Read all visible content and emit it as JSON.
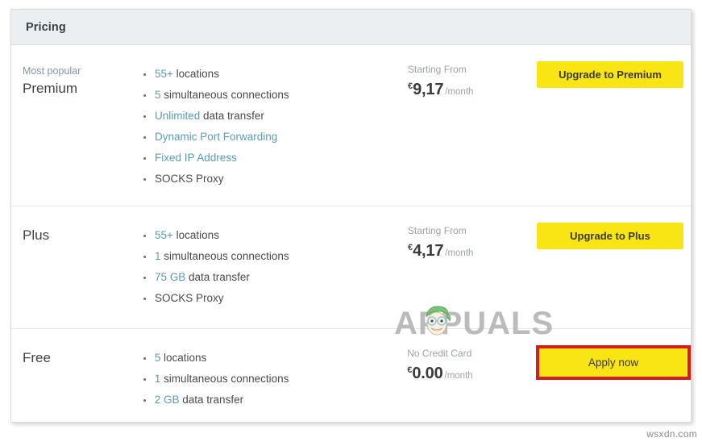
{
  "card": {
    "header_title": "Pricing"
  },
  "plans": [
    {
      "badge": "Most popular",
      "name": "Premium",
      "features": [
        {
          "highlight": "55+",
          "rest": " locations"
        },
        {
          "highlight": "5",
          "rest": " simultaneous connections"
        },
        {
          "highlight": "Unlimited",
          "rest": " data transfer"
        },
        {
          "highlight": "Dynamic Port Forwarding",
          "rest": ""
        },
        {
          "highlight": "Fixed IP Address",
          "rest": ""
        },
        {
          "highlight": "",
          "rest": "SOCKS Proxy"
        }
      ],
      "price_caption": "Starting From",
      "currency": "€",
      "amount": "9,17",
      "period": "/month",
      "button_label": "Upgrade to Premium",
      "highlighted": false
    },
    {
      "badge": "",
      "name": "Plus",
      "features": [
        {
          "highlight": "55+",
          "rest": " locations"
        },
        {
          "highlight": "1",
          "rest": " simultaneous connections"
        },
        {
          "highlight": "75 GB",
          "rest": " data transfer"
        },
        {
          "highlight": "",
          "rest": "SOCKS Proxy"
        }
      ],
      "price_caption": "Starting From",
      "currency": "€",
      "amount": "4,17",
      "period": "/month",
      "button_label": "Upgrade to Plus",
      "highlighted": false
    },
    {
      "badge": "",
      "name": "Free",
      "features": [
        {
          "highlight": "5",
          "rest": " locations"
        },
        {
          "highlight": "1",
          "rest": " simultaneous connections"
        },
        {
          "highlight": "2 GB",
          "rest": " data transfer"
        }
      ],
      "price_caption": "No Credit Card",
      "currency": "€",
      "amount": "0.00",
      "period": "/month",
      "button_label": "Apply now",
      "highlighted": true
    }
  ],
  "watermarks": {
    "appuals": "APPUALS",
    "site": "wsxdn.com"
  },
  "colors": {
    "accent_yellow": "#f9e514",
    "link_blue": "#5b9bb5",
    "annotation_red": "#d61d1d",
    "header_bg": "#eceff1"
  }
}
